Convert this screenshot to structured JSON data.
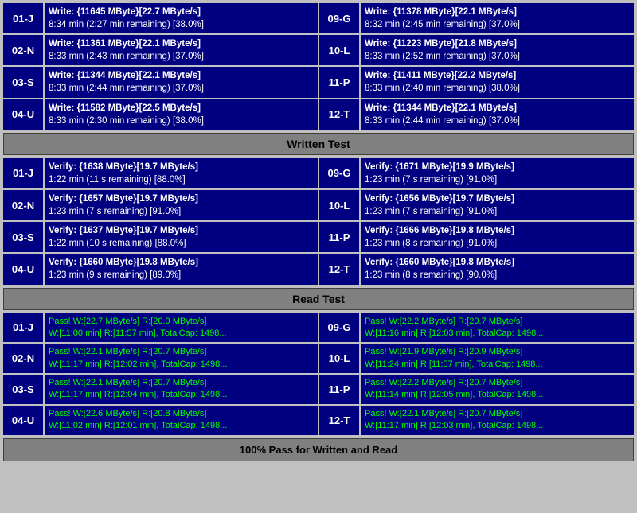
{
  "write_section": {
    "rows_left": [
      {
        "id": "01-J",
        "line1": "Write: {11645 MByte}[22.7 MByte/s]",
        "line2": "8:34 min (2:27 min remaining)  [38.0%]"
      },
      {
        "id": "02-N",
        "line1": "Write: {11361 MByte}[22.1 MByte/s]",
        "line2": "8:33 min (2:43 min remaining)  [37.0%]"
      },
      {
        "id": "03-S",
        "line1": "Write: {11344 MByte}[22.1 MByte/s]",
        "line2": "8:33 min (2:44 min remaining)  [37.0%]"
      },
      {
        "id": "04-U",
        "line1": "Write: {11582 MByte}[22.5 MByte/s]",
        "line2": "8:33 min (2:30 min remaining)  [38.0%]"
      }
    ],
    "rows_right": [
      {
        "id": "09-G",
        "line1": "Write: {11378 MByte}[22.1 MByte/s]",
        "line2": "8:32 min (2:45 min remaining)  [37.0%]"
      },
      {
        "id": "10-L",
        "line1": "Write: {11223 MByte}[21.8 MByte/s]",
        "line2": "8:33 min (2:52 min remaining)  [37.0%]"
      },
      {
        "id": "11-P",
        "line1": "Write: {11411 MByte}[22.2 MByte/s]",
        "line2": "8:33 min (2:40 min remaining)  [38.0%]"
      },
      {
        "id": "12-T",
        "line1": "Write: {11344 MByte}[22.1 MByte/s]",
        "line2": "8:33 min (2:44 min remaining)  [37.0%]"
      }
    ]
  },
  "written_test_label": "Written Test",
  "verify_section": {
    "rows_left": [
      {
        "id": "01-J",
        "line1": "Verify: {1638 MByte}[19.7 MByte/s]",
        "line2": "1:22 min (11 s remaining)  [88.0%]"
      },
      {
        "id": "02-N",
        "line1": "Verify: {1657 MByte}[19.7 MByte/s]",
        "line2": "1:23 min (7 s remaining)  [91.0%]"
      },
      {
        "id": "03-S",
        "line1": "Verify: {1637 MByte}[19.7 MByte/s]",
        "line2": "1:22 min (10 s remaining)  [88.0%]"
      },
      {
        "id": "04-U",
        "line1": "Verify: {1660 MByte}[19.8 MByte/s]",
        "line2": "1:23 min (9 s remaining)  [89.0%]"
      }
    ],
    "rows_right": [
      {
        "id": "09-G",
        "line1": "Verify: {1671 MByte}[19.9 MByte/s]",
        "line2": "1:23 min (7 s remaining)  [91.0%]"
      },
      {
        "id": "10-L",
        "line1": "Verify: {1656 MByte}[19.7 MByte/s]",
        "line2": "1:23 min (7 s remaining)  [91.0%]"
      },
      {
        "id": "11-P",
        "line1": "Verify: {1666 MByte}[19.8 MByte/s]",
        "line2": "1:23 min (8 s remaining)  [91.0%]"
      },
      {
        "id": "12-T",
        "line1": "Verify: {1660 MByte}[19.8 MByte/s]",
        "line2": "1:23 min (8 s remaining)  [90.0%]"
      }
    ]
  },
  "read_test_label": "Read Test",
  "pass_section": {
    "rows_left": [
      {
        "id": "01-J",
        "line1": "Pass! W:[22.7 MByte/s] R:[20.9 MByte/s]",
        "line2": "W:[11:00 min] R:[11:57 min], TotalCap: 1498..."
      },
      {
        "id": "02-N",
        "line1": "Pass! W:[22.1 MByte/s] R:[20.7 MByte/s]",
        "line2": "W:[11:17 min] R:[12:02 min], TotalCap: 1498..."
      },
      {
        "id": "03-S",
        "line1": "Pass! W:[22.1 MByte/s] R:[20.7 MByte/s]",
        "line2": "W:[11:17 min] R:[12:04 min], TotalCap: 1498..."
      },
      {
        "id": "04-U",
        "line1": "Pass! W:[22.6 MByte/s] R:[20.8 MByte/s]",
        "line2": "W:[11:02 min] R:[12:01 min], TotalCap: 1498..."
      }
    ],
    "rows_right": [
      {
        "id": "09-G",
        "line1": "Pass! W:[22.2 MByte/s] R:[20.7 MByte/s]",
        "line2": "W:[11:16 min] R:[12:03 min], TotalCap: 1498..."
      },
      {
        "id": "10-L",
        "line1": "Pass! W:[21.9 MByte/s] R:[20.9 MByte/s]",
        "line2": "W:[11:24 min] R:[11:57 min], TotalCap: 1498..."
      },
      {
        "id": "11-P",
        "line1": "Pass! W:[22.2 MByte/s] R:[20.7 MByte/s]",
        "line2": "W:[11:14 min] R:[12:05 min], TotalCap: 1498..."
      },
      {
        "id": "12-T",
        "line1": "Pass! W:[22.1 MByte/s] R:[20.7 MByte/s]",
        "line2": "W:[11:17 min] R:[12:03 min], TotalCap: 1498..."
      }
    ]
  },
  "bottom_label": "100% Pass for Written and Read"
}
